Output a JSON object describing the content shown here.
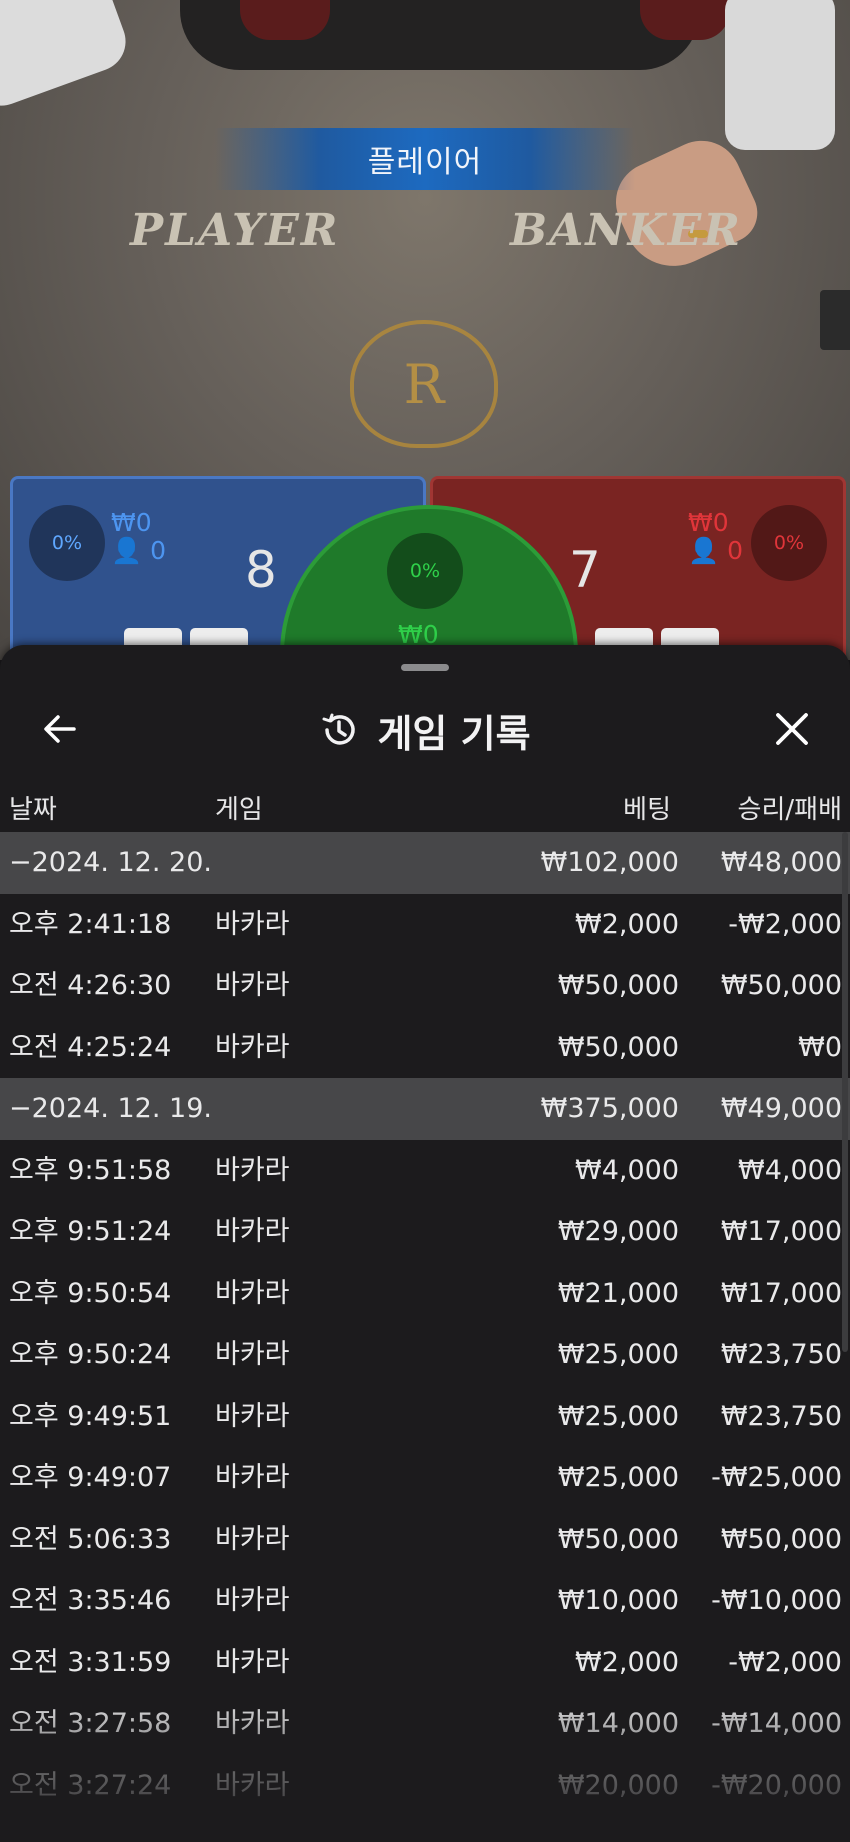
{
  "scene": {
    "result_banner": "플레이어",
    "player_word": "PLAYER",
    "banker_word": "BANKER",
    "crest_letter": "R",
    "player": {
      "percent": "0%",
      "amount": "₩0",
      "count": "0",
      "score": "8",
      "color": "#30528d"
    },
    "banker": {
      "percent": "0%",
      "amount": "₩0",
      "count": "0",
      "score": "7",
      "color": "#7a2422"
    },
    "tie": {
      "percent": "0%",
      "amount": "₩0",
      "color": "#1f7a2a"
    }
  },
  "sheet": {
    "title": "게임 기록",
    "back_icon": "arrow-left-icon",
    "history_icon": "history-icon",
    "close_icon": "close-icon",
    "columns": {
      "date": "날짜",
      "game": "게임",
      "bet": "베팅",
      "win": "승리/패배"
    }
  },
  "rows": [
    {
      "type": "group",
      "date": "−2024. 12. 20.",
      "game": "",
      "bet": "₩102,000",
      "win": "₩48,000"
    },
    {
      "type": "item",
      "date": "오후 2:41:18",
      "game": "바카라",
      "bet": "₩2,000",
      "win": "-₩2,000"
    },
    {
      "type": "item",
      "date": "오전 4:26:30",
      "game": "바카라",
      "bet": "₩50,000",
      "win": "₩50,000"
    },
    {
      "type": "item",
      "date": "오전 4:25:24",
      "game": "바카라",
      "bet": "₩50,000",
      "win": "₩0"
    },
    {
      "type": "group",
      "date": "−2024. 12. 19.",
      "game": "",
      "bet": "₩375,000",
      "win": "₩49,000"
    },
    {
      "type": "item",
      "date": "오후 9:51:58",
      "game": "바카라",
      "bet": "₩4,000",
      "win": "₩4,000"
    },
    {
      "type": "item",
      "date": "오후 9:51:24",
      "game": "바카라",
      "bet": "₩29,000",
      "win": "₩17,000"
    },
    {
      "type": "item",
      "date": "오후 9:50:54",
      "game": "바카라",
      "bet": "₩21,000",
      "win": "₩17,000"
    },
    {
      "type": "item",
      "date": "오후 9:50:24",
      "game": "바카라",
      "bet": "₩25,000",
      "win": "₩23,750"
    },
    {
      "type": "item",
      "date": "오후 9:49:51",
      "game": "바카라",
      "bet": "₩25,000",
      "win": "₩23,750"
    },
    {
      "type": "item",
      "date": "오후 9:49:07",
      "game": "바카라",
      "bet": "₩25,000",
      "win": "-₩25,000"
    },
    {
      "type": "item",
      "date": "오전 5:06:33",
      "game": "바카라",
      "bet": "₩50,000",
      "win": "₩50,000"
    },
    {
      "type": "item",
      "date": "오전 3:35:46",
      "game": "바카라",
      "bet": "₩10,000",
      "win": "-₩10,000"
    },
    {
      "type": "item",
      "date": "오전 3:31:59",
      "game": "바카라",
      "bet": "₩2,000",
      "win": "-₩2,000"
    },
    {
      "type": "item",
      "date": "오전 3:27:58",
      "game": "바카라",
      "bet": "₩14,000",
      "win": "-₩14,000"
    },
    {
      "type": "item",
      "date": "오전 3:27:24",
      "game": "바카라",
      "bet": "₩20,000",
      "win": "-₩20,000"
    }
  ]
}
